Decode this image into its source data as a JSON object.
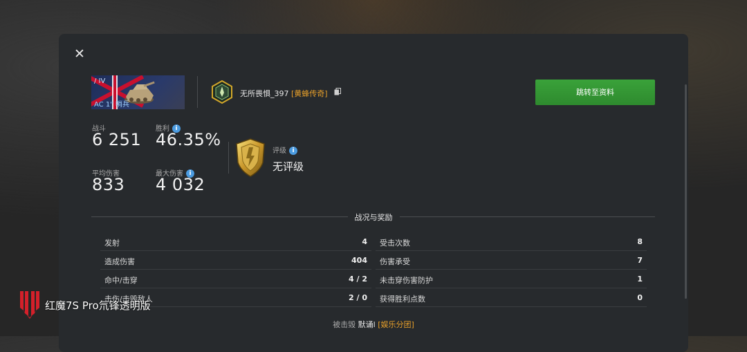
{
  "header": {
    "close_label": "✕",
    "tank_tier": "/ IV",
    "tank_name": "AC 1\" 哨兵",
    "player_name": "无所畏惧_397",
    "player_clan": "[黄蜂传奇]",
    "profile_button": "跳转至资料"
  },
  "stats": {
    "battles_label": "战斗",
    "battles_value": "6 251",
    "wins_label": "胜利",
    "wins_value": "46.35%",
    "avg_damage_label": "平均伤害",
    "avg_damage_value": "833",
    "max_damage_label": "最大伤害",
    "max_damage_value": "4 032",
    "rating_label": "评级",
    "rating_value": "无评级",
    "info_glyph": "i"
  },
  "section": {
    "title": "战况与奖励",
    "left_rows": [
      {
        "label": "发射",
        "value": "4"
      },
      {
        "label": "造成伤害",
        "value": "404"
      },
      {
        "label": "命中/击穿",
        "value": "4 / 2"
      },
      {
        "label": "击伤/击毁敌人",
        "value": "2 / 0"
      }
    ],
    "right_rows": [
      {
        "label": "受击次数",
        "value": "8"
      },
      {
        "label": "伤害承受",
        "value": "7"
      },
      {
        "label": "未击穿伤害防护",
        "value": "1"
      },
      {
        "label": "获得胜利点数",
        "value": "0"
      }
    ]
  },
  "footer": {
    "killed_by_label": "被击毁",
    "killer_name": "默诵l",
    "killer_clan": "[娱乐分团]"
  },
  "watermark": {
    "text": "红魔7S Pro氘锋透明版"
  },
  "colors": {
    "accent_green": "#2e8a2e",
    "clan_orange": "#e8a02a",
    "info_blue": "#4b9be0",
    "panel_bg": "#272a2d"
  },
  "icons": {
    "close": "close-icon",
    "copy": "copy-icon",
    "info": "info-icon",
    "rank": "rank-badge-icon",
    "rating": "rating-shield-icon",
    "watermark": "redmagic-logo-icon"
  }
}
